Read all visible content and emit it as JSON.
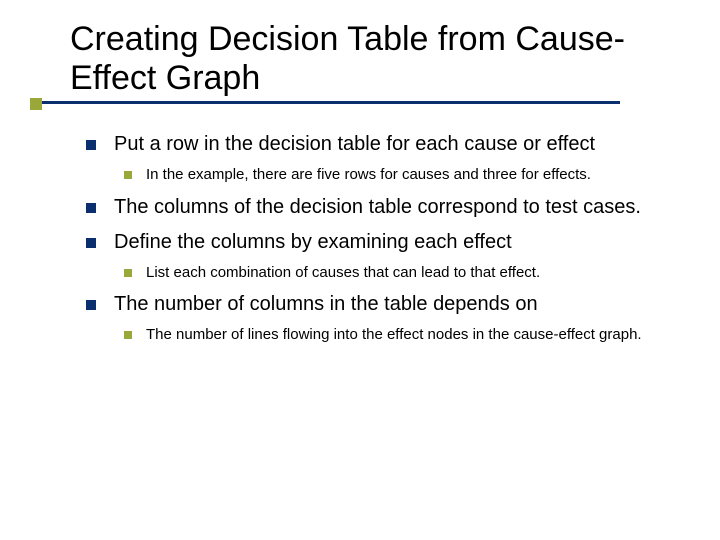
{
  "title": "Creating Decision Table from Cause-Effect Graph",
  "bullets": [
    {
      "text": "Put a row in the decision table for each cause or effect",
      "children": [
        {
          "text": "In the example, there are five rows for causes and three for effects."
        }
      ]
    },
    {
      "text": "The columns of the decision table correspond to test cases."
    },
    {
      "text": "Define the columns by examining each effect",
      "children": [
        {
          "text": "List each combination of causes that can lead to that effect."
        }
      ]
    },
    {
      "text": "The number of columns in the table depends on",
      "children": [
        {
          "text": "The number of lines flowing into the effect nodes in the cause-effect graph."
        }
      ]
    }
  ]
}
